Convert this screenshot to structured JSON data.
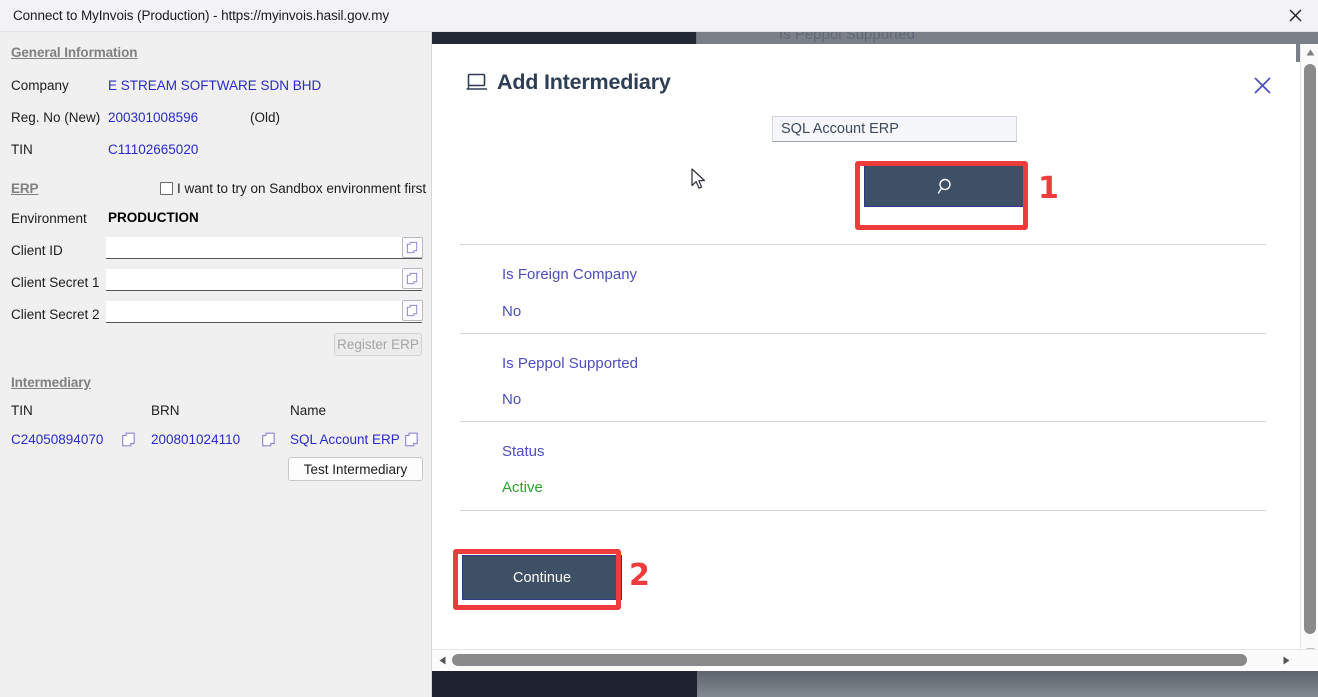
{
  "window": {
    "title": "Connect to MyInvois (Production) - https://myinvois.hasil.gov.my",
    "close_icon": "close-icon"
  },
  "left_panel": {
    "sections": {
      "general_information": "General Information",
      "erp": "ERP",
      "intermediary": "Intermediary"
    },
    "general": [
      {
        "label": "Company",
        "value": "E STREAM SOFTWARE SDN BHD"
      },
      {
        "label": "Reg. No (New)",
        "value": "200301008596",
        "extra": "(Old)",
        "extra_value": ""
      },
      {
        "label": "TIN",
        "value": "C11102665020"
      }
    ],
    "sandbox_checkbox": {
      "label": "I want to try on Sandbox environment first",
      "checked": false
    },
    "erp_fields": [
      {
        "label": "Environment",
        "value": "PRODUCTION",
        "type": "static"
      },
      {
        "label": "Client ID",
        "value": "",
        "type": "input"
      },
      {
        "label": "Client Secret 1",
        "value": "",
        "type": "input"
      },
      {
        "label": "Client Secret 2",
        "value": "",
        "type": "input"
      }
    ],
    "register_erp_button": "Register ERP",
    "intermediary_table": {
      "headers": [
        "TIN",
        "BRN",
        "Name"
      ],
      "rows": [
        {
          "tin": "C24050894070",
          "brn": "200801024110",
          "name": "SQL Account ERP"
        }
      ]
    },
    "test_intermediary_button": "Test Intermediary"
  },
  "background": {
    "ghost_label": "Is Peppol Supported"
  },
  "modal": {
    "title": "Add Intermediary",
    "title_icon": "monitor-icon",
    "close_icon": "close-icon",
    "search": {
      "value": "SQL Account ERP",
      "placeholder": "",
      "button_icon": "search-icon"
    },
    "details": [
      {
        "label": "Is Foreign Company",
        "value": "No",
        "value_color": "#4b4ec0"
      },
      {
        "label": "Is Peppol Supported",
        "value": "No",
        "value_color": "#4b4ec0"
      },
      {
        "label": "Status",
        "value": "Active",
        "value_color": "#2ea12e"
      }
    ],
    "continue_button": "Continue"
  },
  "annotations": [
    {
      "number": "1",
      "target": "search-button"
    },
    {
      "number": "2",
      "target": "continue-button"
    }
  ],
  "colors": {
    "accent_button": "#3e5066",
    "annotation_red": "#ee3b3b",
    "link_blue": "#2a2aca",
    "detail_purple": "#4b4ec0",
    "status_green": "#2ea12e"
  }
}
